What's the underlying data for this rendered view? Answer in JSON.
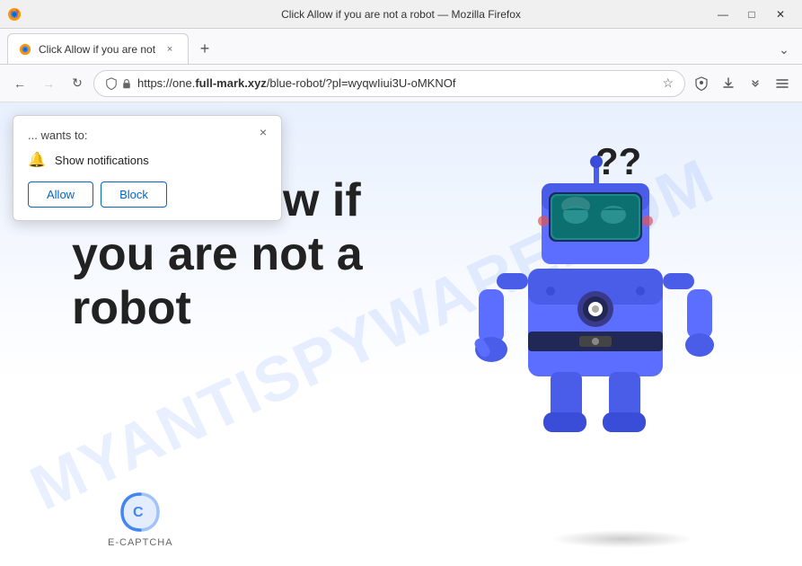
{
  "titleBar": {
    "title": "Click Allow if you are not a robot — Mozilla Firefox",
    "controls": {
      "minimize": "—",
      "maximize": "□",
      "close": "✕"
    }
  },
  "tabBar": {
    "tab": {
      "title": "Click Allow if you are not",
      "close": "×"
    },
    "newTab": "+",
    "chevron": "❯"
  },
  "navBar": {
    "back": "←",
    "forward": "→",
    "reload": "↻",
    "url": "https://one.full-mark.xyz/blue-robot/?pl=wyqwIiui3U-oMKNOf",
    "urlDisplay": "https://one.",
    "urlDomain": "full-mark.xyz",
    "urlPath": "/blue-robot/?pl=wyqwIiui3U-oMKNOf",
    "bookmark": "☆",
    "shield": "🛡",
    "lock": "🔒",
    "download": "⬇",
    "overflow": "≫",
    "menu": "≡"
  },
  "page": {
    "mainText": "Click Allow if\nyou are not a\nrobot",
    "watermark": "MYANTISPYWARE.COM",
    "ecaptchaLabel": "E-CAPTCHA",
    "backgroundColor": "#e8f4fe"
  },
  "popup": {
    "wantsText": "... wants to:",
    "permissionText": "Show notifications",
    "allowLabel": "Allow",
    "blockLabel": "Block",
    "closeIcon": "×"
  }
}
